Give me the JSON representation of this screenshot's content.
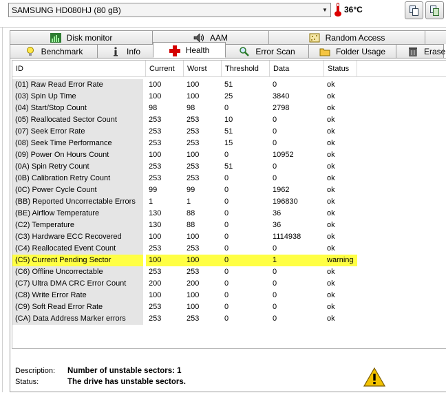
{
  "toolbar": {
    "drive_value": "SAMSUNG HD080HJ (80 gB)",
    "temperature": "36°C"
  },
  "tabs_row1": [
    {
      "label": "Disk monitor",
      "icon": "chart-icon"
    },
    {
      "label": "AAM",
      "icon": "speaker-icon"
    },
    {
      "label": "Random Access",
      "icon": "grid-icon"
    }
  ],
  "tabs_row2": [
    {
      "label": "Benchmark",
      "icon": "lightbulb-icon"
    },
    {
      "label": "Info",
      "icon": "info-icon"
    },
    {
      "label": "Health",
      "icon": "red-cross-icon"
    },
    {
      "label": "Error Scan",
      "icon": "magnifier-icon"
    },
    {
      "label": "Folder Usage",
      "icon": "folder-icon"
    },
    {
      "label": "Erase",
      "icon": "trash-icon"
    }
  ],
  "table": {
    "columns": [
      "ID",
      "Current",
      "Worst",
      "Threshold",
      "Data",
      "Status"
    ],
    "rows": [
      {
        "id": "(01) Raw Read Error Rate",
        "current": "100",
        "worst": "100",
        "threshold": "51",
        "data": "0",
        "status": "ok"
      },
      {
        "id": "(03) Spin Up Time",
        "current": "100",
        "worst": "100",
        "threshold": "25",
        "data": "3840",
        "status": "ok"
      },
      {
        "id": "(04) Start/Stop Count",
        "current": "98",
        "worst": "98",
        "threshold": "0",
        "data": "2798",
        "status": "ok"
      },
      {
        "id": "(05) Reallocated Sector Count",
        "current": "253",
        "worst": "253",
        "threshold": "10",
        "data": "0",
        "status": "ok"
      },
      {
        "id": "(07) Seek Error Rate",
        "current": "253",
        "worst": "253",
        "threshold": "51",
        "data": "0",
        "status": "ok"
      },
      {
        "id": "(08) Seek Time Performance",
        "current": "253",
        "worst": "253",
        "threshold": "15",
        "data": "0",
        "status": "ok"
      },
      {
        "id": "(09) Power On Hours Count",
        "current": "100",
        "worst": "100",
        "threshold": "0",
        "data": "10952",
        "status": "ok"
      },
      {
        "id": "(0A) Spin Retry Count",
        "current": "253",
        "worst": "253",
        "threshold": "51",
        "data": "0",
        "status": "ok"
      },
      {
        "id": "(0B) Calibration Retry Count",
        "current": "253",
        "worst": "253",
        "threshold": "0",
        "data": "0",
        "status": "ok"
      },
      {
        "id": "(0C) Power Cycle Count",
        "current": "99",
        "worst": "99",
        "threshold": "0",
        "data": "1962",
        "status": "ok"
      },
      {
        "id": "(BB) Reported Uncorrectable Errors",
        "current": "1",
        "worst": "1",
        "threshold": "0",
        "data": "196830",
        "status": "ok"
      },
      {
        "id": "(BE) Airflow Temperature",
        "current": "130",
        "worst": "88",
        "threshold": "0",
        "data": "36",
        "status": "ok"
      },
      {
        "id": "(C2) Temperature",
        "current": "130",
        "worst": "88",
        "threshold": "0",
        "data": "36",
        "status": "ok"
      },
      {
        "id": "(C3) Hardware ECC Recovered",
        "current": "100",
        "worst": "100",
        "threshold": "0",
        "data": "1114938",
        "status": "ok"
      },
      {
        "id": "(C4) Reallocated Event Count",
        "current": "253",
        "worst": "253",
        "threshold": "0",
        "data": "0",
        "status": "ok"
      },
      {
        "id": "(C5) Current Pending Sector",
        "current": "100",
        "worst": "100",
        "threshold": "0",
        "data": "1",
        "status": "warning",
        "highlight": true
      },
      {
        "id": "(C6) Offline Uncorrectable",
        "current": "253",
        "worst": "253",
        "threshold": "0",
        "data": "0",
        "status": "ok"
      },
      {
        "id": "(C7) Ultra DMA CRC Error Count",
        "current": "200",
        "worst": "200",
        "threshold": "0",
        "data": "0",
        "status": "ok"
      },
      {
        "id": "(C8) Write Error Rate",
        "current": "100",
        "worst": "100",
        "threshold": "0",
        "data": "0",
        "status": "ok"
      },
      {
        "id": "(C9) Soft Read Error Rate",
        "current": "253",
        "worst": "100",
        "threshold": "0",
        "data": "0",
        "status": "ok"
      },
      {
        "id": "(CA) Data Address Marker errors",
        "current": "253",
        "worst": "253",
        "threshold": "0",
        "data": "0",
        "status": "ok"
      }
    ]
  },
  "details": {
    "description_label": "Description:",
    "description_value": "Number of unstable sectors: 1",
    "status_label": "Status:",
    "status_value": "The drive has unstable sectors."
  },
  "colors": {
    "highlight": "#ffff44",
    "id_column": "#e5e5e5",
    "warning_icon": "#f2c200"
  }
}
